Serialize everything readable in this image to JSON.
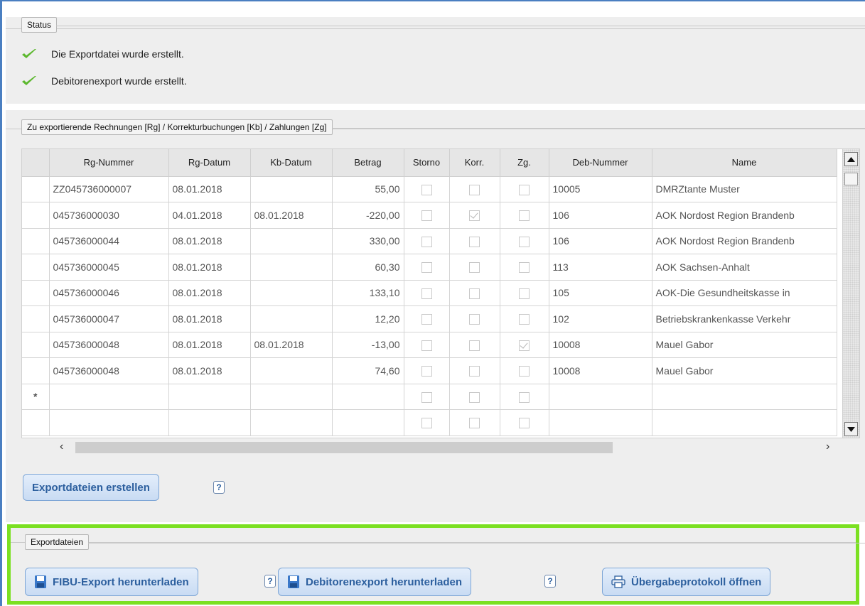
{
  "status": {
    "legend": "Status",
    "messages": [
      "Die Exportdatei wurde erstellt.",
      "Debitorenexport wurde erstellt."
    ]
  },
  "invoices": {
    "legend": "Zu exportierende Rechnungen [Rg] / Korrekturbuchungen [Kb] / Zahlungen [Zg]",
    "columns": [
      "Rg-Nummer",
      "Rg-Datum",
      "Kb-Datum",
      "Betrag",
      "Storno",
      "Korr.",
      "Zg.",
      "Deb-Nummer",
      "Name"
    ],
    "rows": [
      {
        "rg_nummer": "ZZ045736000007",
        "rg_datum": "08.01.2018",
        "kb_datum": "",
        "betrag": "55,00",
        "storno": false,
        "korr": false,
        "zg": false,
        "deb_nummer": "10005",
        "name": "DMRZtante Muster"
      },
      {
        "rg_nummer": "045736000030",
        "rg_datum": "04.01.2018",
        "kb_datum": "08.01.2018",
        "betrag": "-220,00",
        "storno": false,
        "korr": true,
        "zg": false,
        "deb_nummer": "106",
        "name": "AOK Nordost Region Brandenb"
      },
      {
        "rg_nummer": "045736000044",
        "rg_datum": "08.01.2018",
        "kb_datum": "",
        "betrag": "330,00",
        "storno": false,
        "korr": false,
        "zg": false,
        "deb_nummer": "106",
        "name": "AOK Nordost Region Brandenb"
      },
      {
        "rg_nummer": "045736000045",
        "rg_datum": "08.01.2018",
        "kb_datum": "",
        "betrag": "60,30",
        "storno": false,
        "korr": false,
        "zg": false,
        "deb_nummer": "113",
        "name": "AOK Sachsen-Anhalt"
      },
      {
        "rg_nummer": "045736000046",
        "rg_datum": "08.01.2018",
        "kb_datum": "",
        "betrag": "133,10",
        "storno": false,
        "korr": false,
        "zg": false,
        "deb_nummer": "105",
        "name": "AOK-Die Gesundheitskasse in"
      },
      {
        "rg_nummer": "045736000047",
        "rg_datum": "08.01.2018",
        "kb_datum": "",
        "betrag": "12,20",
        "storno": false,
        "korr": false,
        "zg": false,
        "deb_nummer": "102",
        "name": "Betriebskrankenkasse Verkehr"
      },
      {
        "rg_nummer": "045736000048",
        "rg_datum": "08.01.2018",
        "kb_datum": "08.01.2018",
        "betrag": "-13,00",
        "storno": false,
        "korr": false,
        "zg": true,
        "deb_nummer": "10008",
        "name": "Mauel Gabor"
      },
      {
        "rg_nummer": "045736000048",
        "rg_datum": "08.01.2018",
        "kb_datum": "",
        "betrag": "74,60",
        "storno": false,
        "korr": false,
        "zg": false,
        "deb_nummer": "10008",
        "name": "Mauel Gabor"
      }
    ],
    "new_row_marker": "*",
    "create_button": "Exportdateien erstellen",
    "help_mark": "?"
  },
  "exports": {
    "legend": "Exportdateien",
    "fibu_button": "FIBU-Export herunterladen",
    "debitoren_button": "Debitorenexport herunterladen",
    "protokoll_button": "Übergabeprotokoll öffnen",
    "help_mark": "?"
  },
  "colors": {
    "accent": "#2c5f9e",
    "highlight_border": "#7be021",
    "check": "#5cb82e",
    "frame": "#4a7fc1"
  }
}
